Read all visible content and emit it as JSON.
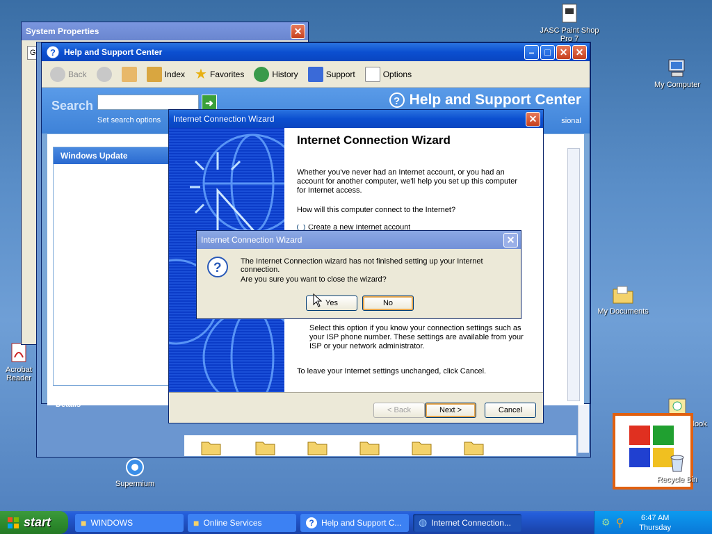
{
  "desktop": {
    "icons": [
      {
        "label": "JASC Paint Shop Pro 7"
      },
      {
        "label": "My Computer"
      },
      {
        "label": "My Documents"
      },
      {
        "label": "Microsoft Outlook"
      },
      {
        "label": "Recycle Bin"
      },
      {
        "label": "Acrobat Reader"
      },
      {
        "label": "Supermium"
      }
    ]
  },
  "system_properties": {
    "title": "System Properties",
    "tab_fragment": "Ge"
  },
  "help_center": {
    "title": "Help and Support Center",
    "toolbar": {
      "back": "Back",
      "index": "Index",
      "favorites": "Favorites",
      "history": "History",
      "support": "Support",
      "options": "Options"
    },
    "search_label": "Search",
    "search_value": "",
    "set_search_options": "Set search options",
    "brand": "Help and Support Center",
    "brand_sub": "sional",
    "sidebar_title": "Windows Update",
    "details_label": "Details"
  },
  "wizard": {
    "title": "Internet Connection Wizard",
    "heading": "Internet Connection Wizard",
    "intro": "Whether you've never had an Internet account, or you had an account for another computer, we'll help you set up this computer for Internet access.",
    "question": "How will this computer connect to the Internet?",
    "option_partial": "Create a new Internet account",
    "manual_desc": "Select this option if you know your connection settings such as your ISP phone number.  These settings are available from your ISP or your network administrator.",
    "cancel_note": "To leave your Internet settings unchanged, click Cancel.",
    "back_btn": "< Back",
    "next_btn": "Next >",
    "cancel_btn": "Cancel"
  },
  "confirm": {
    "title": "Internet Connection Wizard",
    "message": "The Internet Connection wizard has not finished setting up your Internet connection.",
    "question": "Are you sure you want to close the wizard?",
    "yes": "Yes",
    "no": "No"
  },
  "taskbar": {
    "start": "start",
    "tasks": [
      {
        "label": "WINDOWS"
      },
      {
        "label": "Online Services"
      },
      {
        "label": "Help and Support C..."
      },
      {
        "label": "Internet Connection..."
      }
    ],
    "time": "6:47 AM",
    "day": "Thursday"
  },
  "colors": {
    "accent": "#0b4fd0",
    "taskbar": "#245edb",
    "start": "#2e8b2e"
  }
}
